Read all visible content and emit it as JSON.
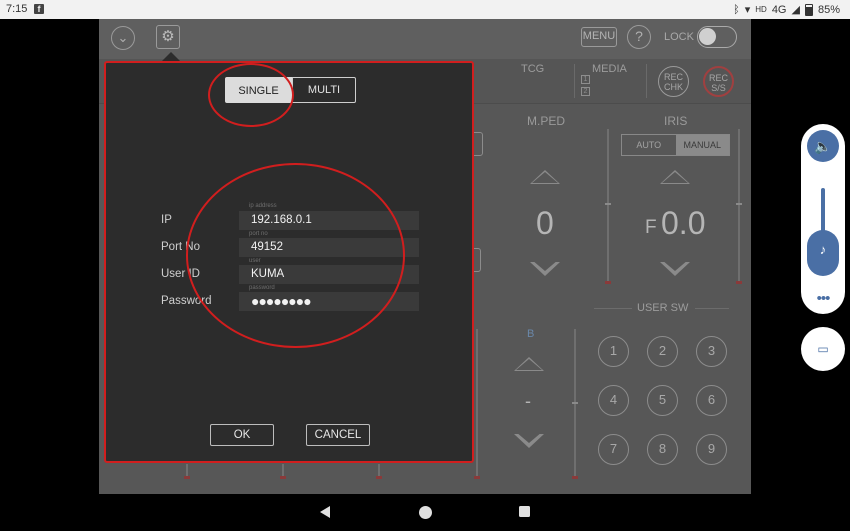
{
  "status_bar": {
    "time": "7:15",
    "network": "4G",
    "hd": "HD",
    "battery": "85%"
  },
  "toolbar": {
    "menu_label": "MENU",
    "help_label": "?",
    "lock_label": "LOCK"
  },
  "header": {
    "tcg_label": "TCG",
    "media_label": "MEDIA",
    "media_slot_1": "1",
    "media_slot_2": "2",
    "rec_chk": "REC CHK",
    "rec_ss": "REC S/S"
  },
  "panels": {
    "mped_title": "M.PED",
    "mped_value": "0",
    "iris_title": "IRIS",
    "iris_modes": [
      "AUTO",
      "MANUAL"
    ],
    "iris_selected": "MANUAL",
    "iris_f": "F",
    "iris_value": "0.0",
    "b_label": "B",
    "b_value": "-",
    "user_sw_title": "USER SW",
    "user_sw_buttons": [
      "1",
      "2",
      "3",
      "4",
      "5",
      "6",
      "7",
      "8",
      "9"
    ]
  },
  "dialog": {
    "mode_tabs": [
      "SINGLE",
      "MULTI"
    ],
    "selected_mode": "SINGLE",
    "fields": [
      {
        "label": "IP",
        "value": "192.168.0.1",
        "hint": "ip address"
      },
      {
        "label": "Port No",
        "value": "49152",
        "hint": "port no"
      },
      {
        "label": "User ID",
        "value": "KUMA",
        "hint": "user"
      },
      {
        "label": "Password",
        "value": "●●●●●●●●",
        "hint": "password"
      }
    ],
    "ok_label": "OK",
    "cancel_label": "CANCEL"
  },
  "accent_colors": {
    "annotation": "#d11e1e",
    "volume": "#4a6fa5"
  }
}
